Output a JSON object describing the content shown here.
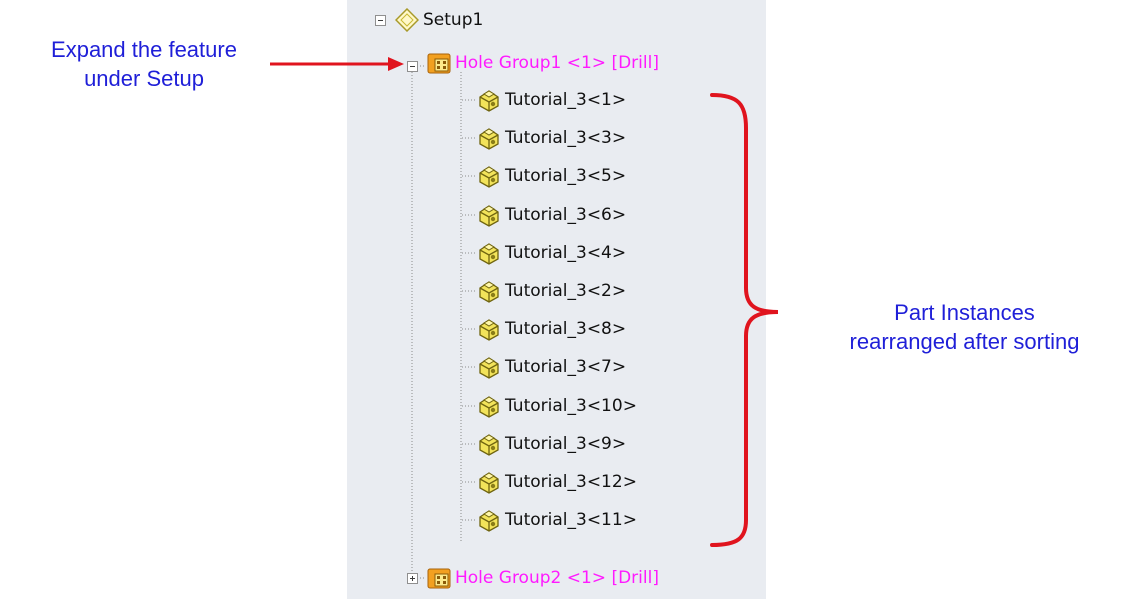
{
  "tree": {
    "setup": {
      "label": "Setup1",
      "icon": "setup-diamond-icon"
    },
    "hole_group_1": {
      "label": "Hole Group1 <1> [Drill]",
      "icon": "hole-group-icon",
      "expanded": true
    },
    "parts": [
      {
        "label": "Tutorial_3<1>"
      },
      {
        "label": "Tutorial_3<3>"
      },
      {
        "label": "Tutorial_3<5>"
      },
      {
        "label": "Tutorial_3<6>"
      },
      {
        "label": "Tutorial_3<4>"
      },
      {
        "label": "Tutorial_3<2>"
      },
      {
        "label": "Tutorial_3<8>"
      },
      {
        "label": "Tutorial_3<7>"
      },
      {
        "label": "Tutorial_3<10>"
      },
      {
        "label": "Tutorial_3<9>"
      },
      {
        "label": "Tutorial_3<12>"
      },
      {
        "label": "Tutorial_3<11>"
      }
    ],
    "hole_group_2": {
      "label": "Hole Group2 <1> [Drill]",
      "icon": "hole-group-icon",
      "expanded": false
    },
    "part_icon": "part-instance-icon"
  },
  "annotations": {
    "left_line1": "Expand the feature",
    "left_line2": "under Setup",
    "right_line1": "Part Instances",
    "right_line2": "rearranged after sorting"
  },
  "colors": {
    "panel_bg": "#e9ecf1",
    "group_text": "#ff1aff",
    "annotation_text": "#1f1fd8",
    "annotation_arrow": "#e0141e"
  }
}
